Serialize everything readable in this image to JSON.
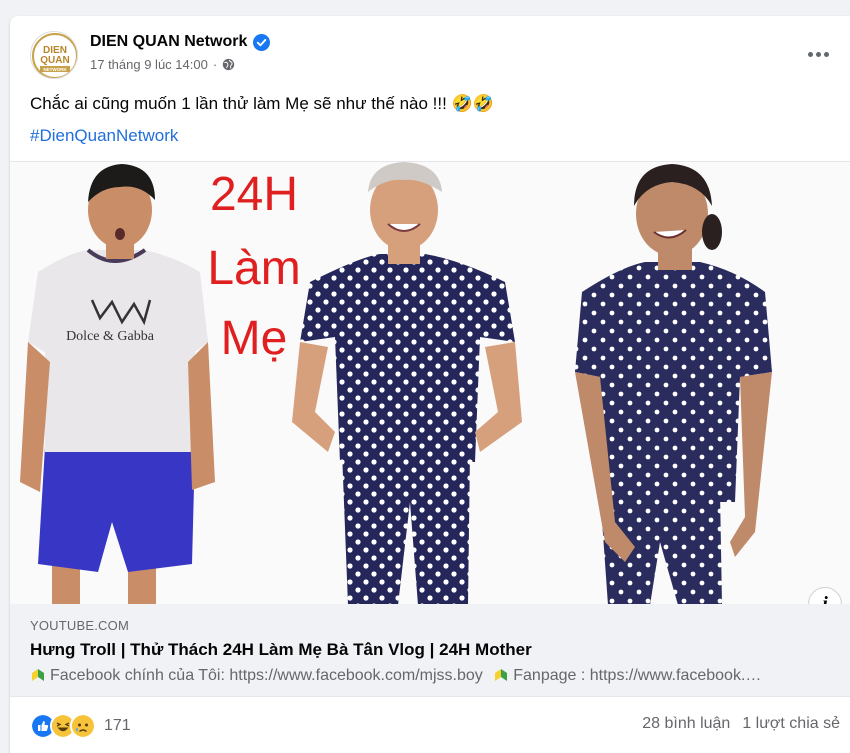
{
  "post": {
    "page_name": "DIEN QUAN Network",
    "timestamp": "17 tháng 9 lúc 14:00",
    "separator": "·",
    "text": "Chắc ai cũng muốn 1 lần thử làm Mẹ sẽ như thế nào !!! 🤣🤣",
    "hashtag": "#DienQuanNetwork"
  },
  "avatar": {
    "logo_line1": "DIEN",
    "logo_line2": "QUAN",
    "logo_line3": "NETWORK"
  },
  "thumbnail": {
    "overlay_line1": "24H",
    "overlay_line2": "Làm",
    "overlay_line3": "Mẹ",
    "shirt_text": "Dolce & Gabba"
  },
  "link_preview": {
    "domain": "YOUTUBE.COM",
    "title": "Hưng Troll | Thử Thách 24H Làm Mẹ Bà Tân Vlog | 24H Mother",
    "description_part1": "Facebook chính của Tôi: https://www.facebook.com/mjss.boy",
    "description_part2": "Fanpage : https://www.facebook.…"
  },
  "footer": {
    "reaction_count": "171",
    "comments": "28 bình luận",
    "shares": "1 lượt chia sẻ"
  },
  "icons": {
    "verified": "verified-badge-icon",
    "globe": "globe-icon",
    "more": "more-options-icon",
    "info": "info-icon",
    "like": "like-reaction-icon",
    "haha": "haha-reaction-icon",
    "sad": "sad-reaction-icon",
    "leaf": "beginner-leaf-icon"
  },
  "colors": {
    "hashtag": "#216fdb",
    "verified": "#1877f2",
    "overlay_text": "#e02020",
    "polka_navy": "#25275a"
  }
}
